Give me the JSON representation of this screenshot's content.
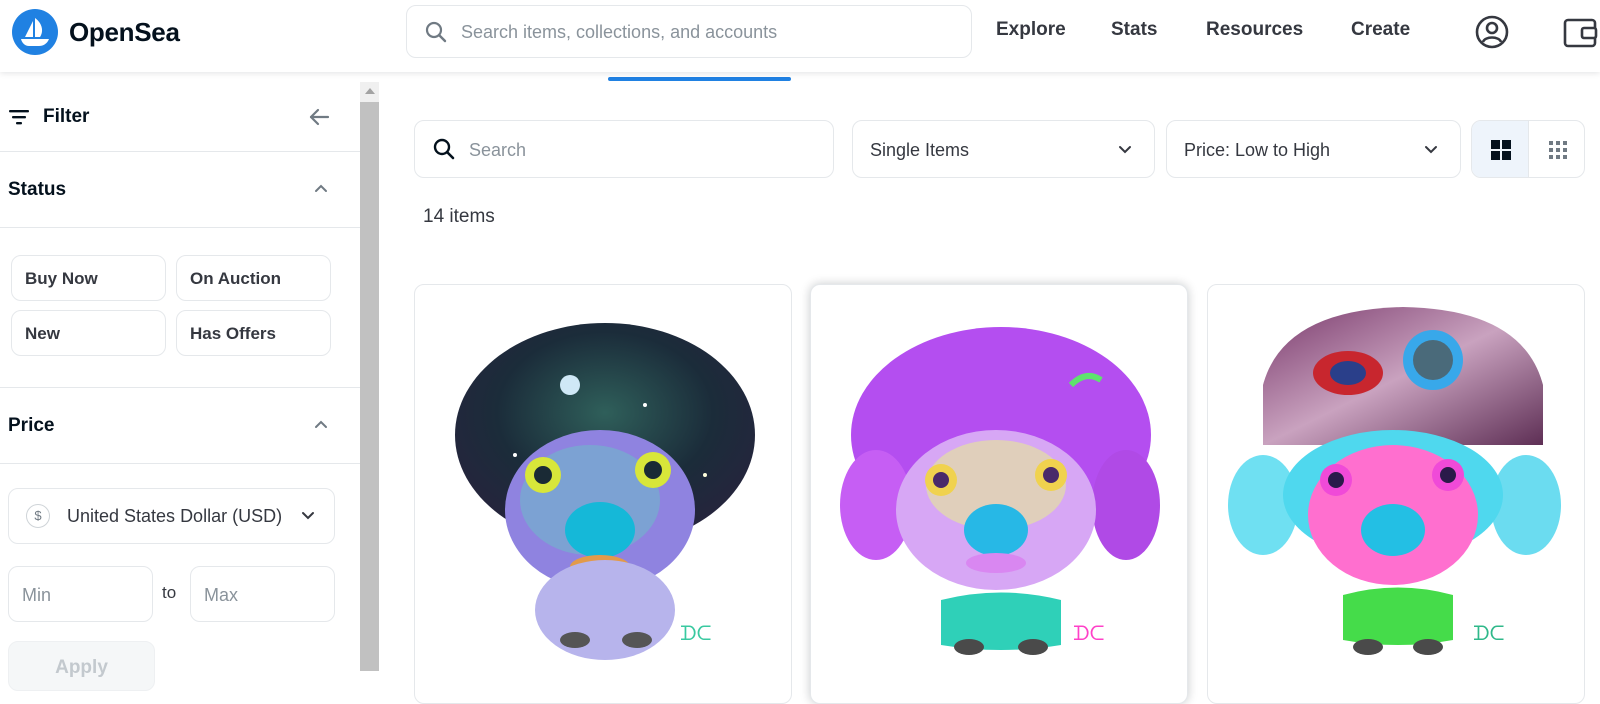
{
  "header": {
    "brand": "OpenSea",
    "search_placeholder": "Search items, collections, and accounts",
    "nav": [
      "Explore",
      "Stats",
      "Resources",
      "Create"
    ]
  },
  "sidebar": {
    "filter_title": "Filter",
    "status": {
      "title": "Status",
      "options": [
        "Buy Now",
        "On Auction",
        "New",
        "Has Offers"
      ]
    },
    "price": {
      "title": "Price",
      "currency": "United States Dollar (USD)",
      "currency_symbol": "$",
      "min_placeholder": "Min",
      "to_label": "to",
      "max_placeholder": "Max",
      "apply_label": "Apply"
    }
  },
  "main": {
    "search_placeholder": "Search",
    "type_filter": "Single Items",
    "sort": "Price: Low to High",
    "item_count": "14 items",
    "cards": [
      {
        "alt": "Space-galaxy poodle NFT artwork"
      },
      {
        "alt": "Purple pastel poodle NFT artwork"
      },
      {
        "alt": "Poodle with marbled hat NFT artwork"
      }
    ]
  },
  "colors": {
    "accent": "#2081e2",
    "text": "#04111d",
    "muted": "#8a939b",
    "border": "#e5e8eb"
  }
}
